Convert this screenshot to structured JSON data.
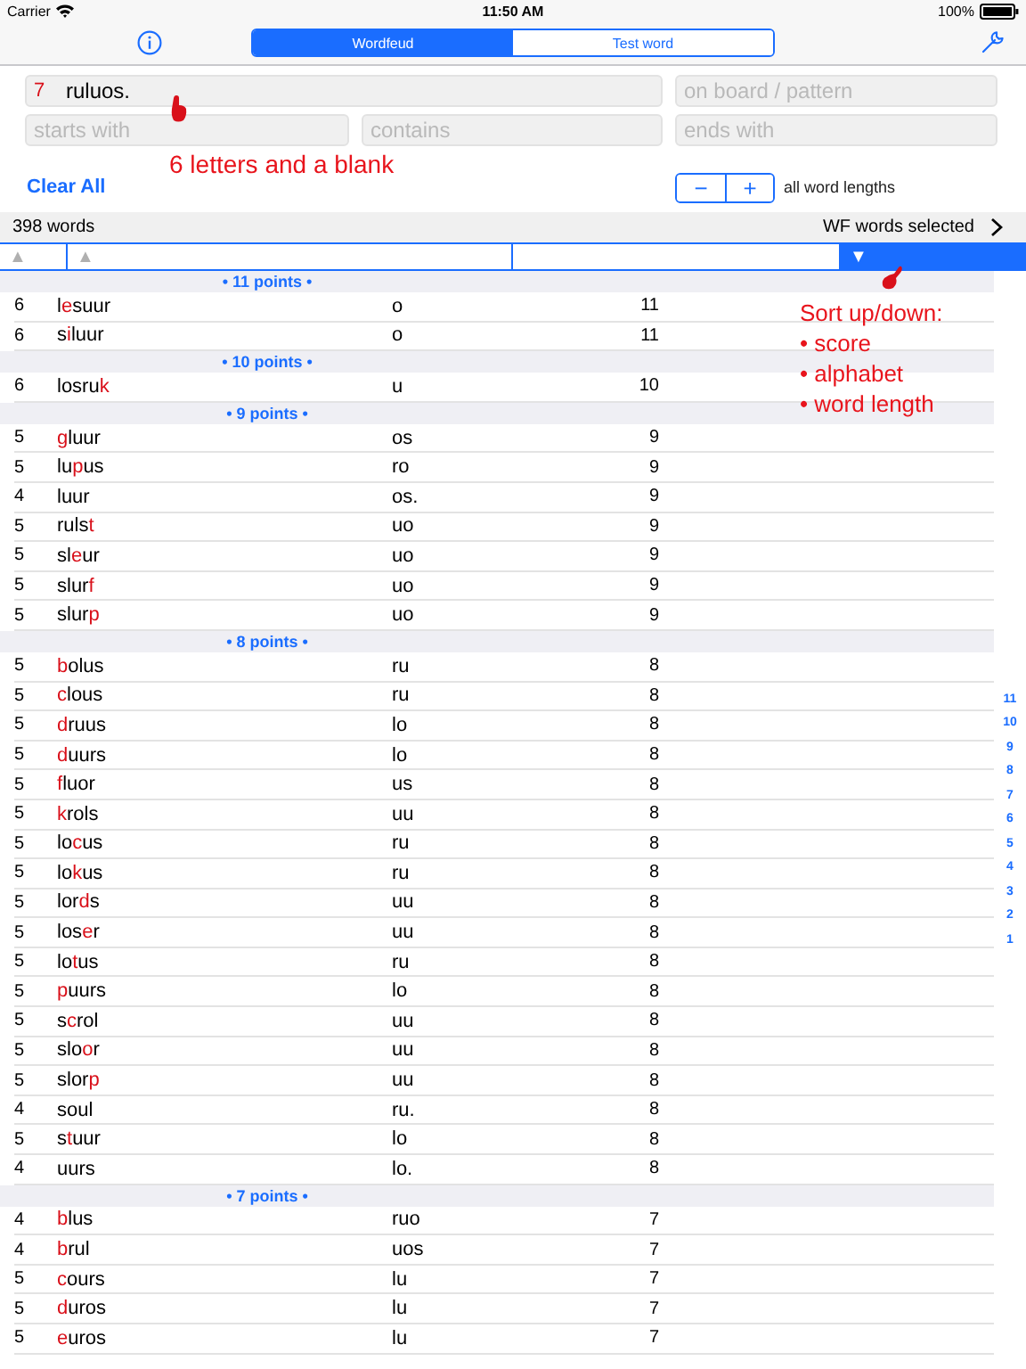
{
  "status_bar": {
    "carrier": "Carrier",
    "time": "11:50 AM",
    "battery": "100%"
  },
  "segments": [
    {
      "label": "Wordfeud",
      "selected": true
    },
    {
      "label": "Test word",
      "selected": false
    }
  ],
  "search": {
    "count": "7",
    "value": "ruluos.",
    "pattern": {
      "placeholder": "on board / pattern"
    },
    "starts": {
      "placeholder": "starts with"
    },
    "contains": {
      "placeholder": "contains"
    },
    "ends": {
      "placeholder": "ends with"
    }
  },
  "clear_all": "Clear All",
  "stepper": {
    "minus": "−",
    "plus": "+",
    "label": "all word lengths"
  },
  "summary": {
    "count": "398 words",
    "selection": "WF words selected"
  },
  "sort_columns": [
    {
      "arrow": "▲",
      "selected": false
    },
    {
      "arrow": "▲",
      "selected": false
    },
    {
      "selected": false
    },
    {
      "arrow": "▼",
      "selected": true
    }
  ],
  "sections": [
    {
      "title": "• 11 points •",
      "rows": [
        {
          "length": "6",
          "before": "l",
          "blank": "e",
          "after": "suur",
          "letters": "o",
          "score": "11"
        },
        {
          "length": "6",
          "before": "s",
          "blank": "i",
          "after": "luur",
          "letters": "o",
          "score": "11"
        }
      ]
    },
    {
      "title": "• 10 points •",
      "rows": [
        {
          "length": "6",
          "before": "losru",
          "blank": "k",
          "after": "",
          "letters": "u",
          "score": "10"
        }
      ]
    },
    {
      "title": "• 9 points •",
      "rows": [
        {
          "length": "5",
          "before": "",
          "blank": "g",
          "after": "luur",
          "letters": "os",
          "score": "9"
        },
        {
          "length": "5",
          "before": "lu",
          "blank": "p",
          "after": "us",
          "letters": "ro",
          "score": "9"
        },
        {
          "length": "4",
          "before": "luur",
          "letters": "os.",
          "score": "9"
        },
        {
          "length": "5",
          "before": "ruls",
          "blank": "t",
          "after": "",
          "letters": "uo",
          "score": "9"
        },
        {
          "length": "5",
          "before": "sl",
          "blank": "e",
          "after": "ur",
          "letters": "uo",
          "score": "9"
        },
        {
          "length": "5",
          "before": "slur",
          "blank": "f",
          "after": "",
          "letters": "uo",
          "score": "9"
        },
        {
          "length": "5",
          "before": "slur",
          "blank": "p",
          "after": "",
          "letters": "uo",
          "score": "9"
        }
      ]
    },
    {
      "title": "• 8 points •",
      "rows": [
        {
          "length": "5",
          "before": "",
          "blank": "b",
          "after": "olus",
          "letters": "ru",
          "score": "8"
        },
        {
          "length": "5",
          "before": "",
          "blank": "c",
          "after": "lous",
          "letters": "ru",
          "score": "8"
        },
        {
          "length": "5",
          "before": "",
          "blank": "d",
          "after": "ruus",
          "letters": "lo",
          "score": "8"
        },
        {
          "length": "5",
          "before": "",
          "blank": "d",
          "after": "uurs",
          "letters": "lo",
          "score": "8"
        },
        {
          "length": "5",
          "before": "",
          "blank": "f",
          "after": "luor",
          "letters": "us",
          "score": "8"
        },
        {
          "length": "5",
          "before": "",
          "blank": "k",
          "after": "rols",
          "letters": "uu",
          "score": "8"
        },
        {
          "length": "5",
          "before": "lo",
          "blank": "c",
          "after": "us",
          "letters": "ru",
          "score": "8"
        },
        {
          "length": "5",
          "before": "lo",
          "blank": "k",
          "after": "us",
          "letters": "ru",
          "score": "8"
        },
        {
          "length": "5",
          "before": "lor",
          "blank": "d",
          "after": "s",
          "letters": "uu",
          "score": "8"
        },
        {
          "length": "5",
          "before": "los",
          "blank": "e",
          "after": "r",
          "letters": "uu",
          "score": "8"
        },
        {
          "length": "5",
          "before": "lo",
          "blank": "t",
          "after": "us",
          "letters": "ru",
          "score": "8"
        },
        {
          "length": "5",
          "before": "",
          "blank": "p",
          "after": "uurs",
          "letters": "lo",
          "score": "8"
        },
        {
          "length": "5",
          "before": "s",
          "blank": "c",
          "after": "rol",
          "letters": "uu",
          "score": "8"
        },
        {
          "length": "5",
          "before": "slo",
          "blank": "o",
          "after": "r",
          "letters": "uu",
          "score": "8"
        },
        {
          "length": "5",
          "before": "slor",
          "blank": "p",
          "after": "",
          "letters": "uu",
          "score": "8"
        },
        {
          "length": "4",
          "before": "soul",
          "letters": "ru.",
          "score": "8"
        },
        {
          "length": "5",
          "before": "s",
          "blank": "t",
          "after": "uur",
          "letters": "lo",
          "score": "8"
        },
        {
          "length": "4",
          "before": "uurs",
          "letters": "lo.",
          "score": "8"
        }
      ]
    },
    {
      "title": "• 7 points •",
      "rows": [
        {
          "length": "4",
          "before": "",
          "blank": "b",
          "after": "lus",
          "letters": "ruo",
          "score": "7"
        },
        {
          "length": "4",
          "before": "",
          "blank": "b",
          "after": "rul",
          "letters": "uos",
          "score": "7"
        },
        {
          "length": "5",
          "before": "",
          "blank": "c",
          "after": "ours",
          "letters": "lu",
          "score": "7"
        },
        {
          "length": "5",
          "before": "",
          "blank": "d",
          "after": "uros",
          "letters": "lu",
          "score": "7"
        },
        {
          "length": "5",
          "before": "",
          "blank": "e",
          "after": "uros",
          "letters": "lu",
          "score": "7"
        }
      ]
    }
  ],
  "index": [
    "11",
    "10",
    "9",
    "8",
    "7",
    "6",
    "5",
    "4",
    "3",
    "2",
    "1"
  ],
  "annotations": {
    "blank_note": "6 letters and a blank",
    "sort_note": "Sort up/down:",
    "sort_items": [
      "• score",
      "• alphabet",
      "• word length"
    ]
  }
}
